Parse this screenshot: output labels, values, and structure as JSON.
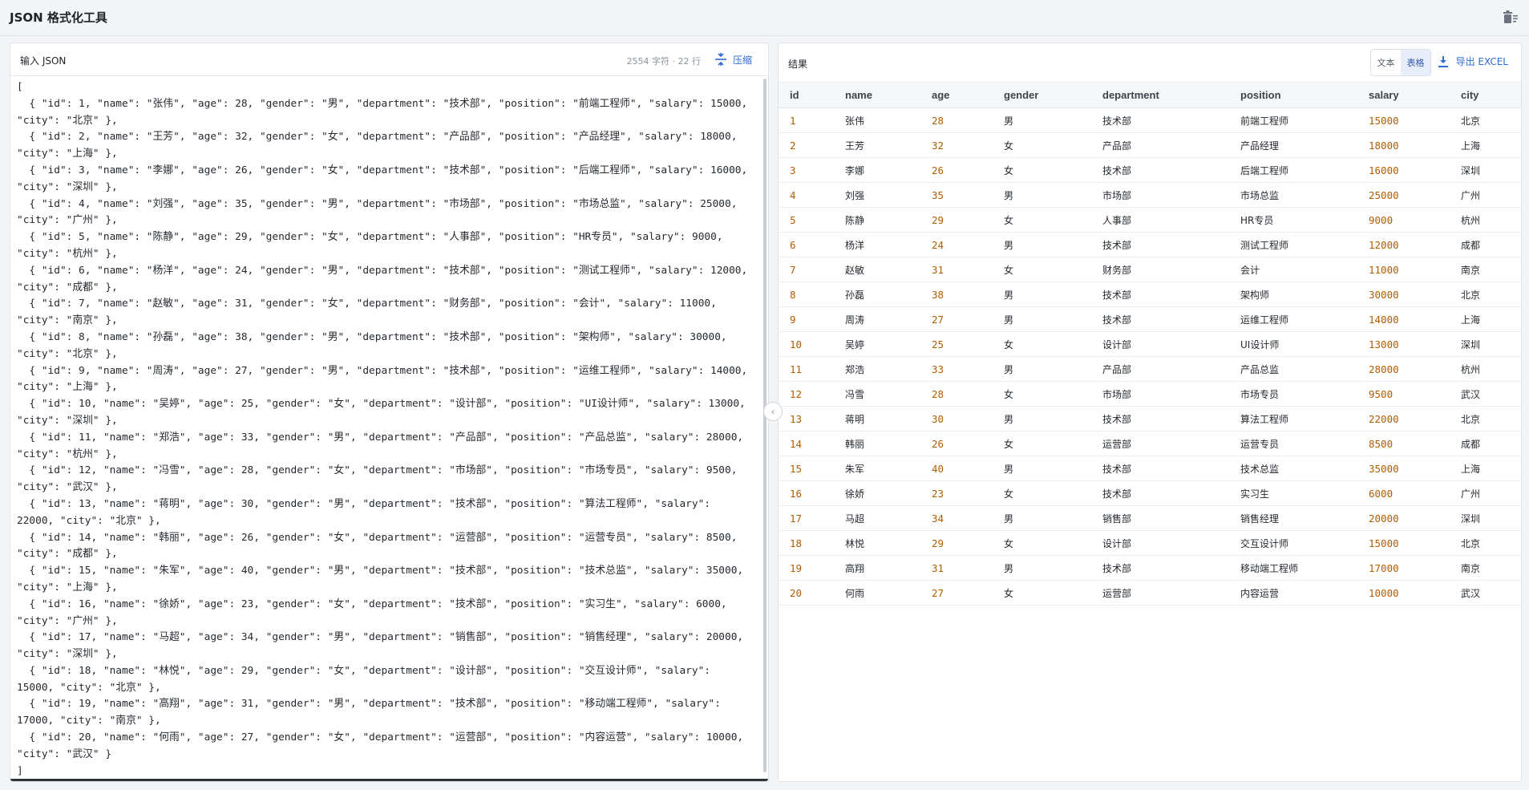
{
  "app": {
    "title": "JSON 格式化工具",
    "trash_icon": "trash-icon"
  },
  "input": {
    "label": "输入 JSON",
    "stats": "2554 字符 · 22 行",
    "compress_label": "压缩",
    "compress_icon": "compress-icon",
    "text": "[\n  { \"id\": 1, \"name\": \"张伟\", \"age\": 28, \"gender\": \"男\", \"department\": \"技术部\", \"position\": \"前端工程师\", \"salary\": 15000,\n\"city\": \"北京\" },\n  { \"id\": 2, \"name\": \"王芳\", \"age\": 32, \"gender\": \"女\", \"department\": \"产品部\", \"position\": \"产品经理\", \"salary\": 18000,\n\"city\": \"上海\" },\n  { \"id\": 3, \"name\": \"李娜\", \"age\": 26, \"gender\": \"女\", \"department\": \"技术部\", \"position\": \"后端工程师\", \"salary\": 16000,\n\"city\": \"深圳\" },\n  { \"id\": 4, \"name\": \"刘强\", \"age\": 35, \"gender\": \"男\", \"department\": \"市场部\", \"position\": \"市场总监\", \"salary\": 25000,\n\"city\": \"广州\" },\n  { \"id\": 5, \"name\": \"陈静\", \"age\": 29, \"gender\": \"女\", \"department\": \"人事部\", \"position\": \"HR专员\", \"salary\": 9000,\n\"city\": \"杭州\" },\n  { \"id\": 6, \"name\": \"杨洋\", \"age\": 24, \"gender\": \"男\", \"department\": \"技术部\", \"position\": \"测试工程师\", \"salary\": 12000,\n\"city\": \"成都\" },\n  { \"id\": 7, \"name\": \"赵敏\", \"age\": 31, \"gender\": \"女\", \"department\": \"财务部\", \"position\": \"会计\", \"salary\": 11000,\n\"city\": \"南京\" },\n  { \"id\": 8, \"name\": \"孙磊\", \"age\": 38, \"gender\": \"男\", \"department\": \"技术部\", \"position\": \"架构师\", \"salary\": 30000,\n\"city\": \"北京\" },\n  { \"id\": 9, \"name\": \"周涛\", \"age\": 27, \"gender\": \"男\", \"department\": \"技术部\", \"position\": \"运维工程师\", \"salary\": 14000,\n\"city\": \"上海\" },\n  { \"id\": 10, \"name\": \"吴婷\", \"age\": 25, \"gender\": \"女\", \"department\": \"设计部\", \"position\": \"UI设计师\", \"salary\": 13000,\n\"city\": \"深圳\" },\n  { \"id\": 11, \"name\": \"郑浩\", \"age\": 33, \"gender\": \"男\", \"department\": \"产品部\", \"position\": \"产品总监\", \"salary\": 28000,\n\"city\": \"杭州\" },\n  { \"id\": 12, \"name\": \"冯雪\", \"age\": 28, \"gender\": \"女\", \"department\": \"市场部\", \"position\": \"市场专员\", \"salary\": 9500,\n\"city\": \"武汉\" },\n  { \"id\": 13, \"name\": \"蒋明\", \"age\": 30, \"gender\": \"男\", \"department\": \"技术部\", \"position\": \"算法工程师\", \"salary\":\n22000, \"city\": \"北京\" },\n  { \"id\": 14, \"name\": \"韩丽\", \"age\": 26, \"gender\": \"女\", \"department\": \"运营部\", \"position\": \"运营专员\", \"salary\": 8500,\n\"city\": \"成都\" },\n  { \"id\": 15, \"name\": \"朱军\", \"age\": 40, \"gender\": \"男\", \"department\": \"技术部\", \"position\": \"技术总监\", \"salary\": 35000,\n\"city\": \"上海\" },\n  { \"id\": 16, \"name\": \"徐娇\", \"age\": 23, \"gender\": \"女\", \"department\": \"技术部\", \"position\": \"实习生\", \"salary\": 6000,\n\"city\": \"广州\" },\n  { \"id\": 17, \"name\": \"马超\", \"age\": 34, \"gender\": \"男\", \"department\": \"销售部\", \"position\": \"销售经理\", \"salary\": 20000,\n\"city\": \"深圳\" },\n  { \"id\": 18, \"name\": \"林悦\", \"age\": 29, \"gender\": \"女\", \"department\": \"设计部\", \"position\": \"交互设计师\", \"salary\":\n15000, \"city\": \"北京\" },\n  { \"id\": 19, \"name\": \"高翔\", \"age\": 31, \"gender\": \"男\", \"department\": \"技术部\", \"position\": \"移动端工程师\", \"salary\":\n17000, \"city\": \"南京\" },\n  { \"id\": 20, \"name\": \"何雨\", \"age\": 27, \"gender\": \"女\", \"department\": \"运营部\", \"position\": \"内容运营\", \"salary\": 10000,\n\"city\": \"武汉\" }\n]"
  },
  "result": {
    "label": "结果",
    "view_text": "文本",
    "view_table": "表格",
    "active_view": "表格",
    "export_label": "导出 EXCEL",
    "export_icon": "download-icon",
    "columns": [
      "id",
      "name",
      "age",
      "gender",
      "department",
      "position",
      "salary",
      "city"
    ],
    "rows": [
      [
        "1",
        "张伟",
        "28",
        "男",
        "技术部",
        "前端工程师",
        "15000",
        "北京"
      ],
      [
        "2",
        "王芳",
        "32",
        "女",
        "产品部",
        "产品经理",
        "18000",
        "上海"
      ],
      [
        "3",
        "李娜",
        "26",
        "女",
        "技术部",
        "后端工程师",
        "16000",
        "深圳"
      ],
      [
        "4",
        "刘强",
        "35",
        "男",
        "市场部",
        "市场总监",
        "25000",
        "广州"
      ],
      [
        "5",
        "陈静",
        "29",
        "女",
        "人事部",
        "HR专员",
        "9000",
        "杭州"
      ],
      [
        "6",
        "杨洋",
        "24",
        "男",
        "技术部",
        "测试工程师",
        "12000",
        "成都"
      ],
      [
        "7",
        "赵敏",
        "31",
        "女",
        "财务部",
        "会计",
        "11000",
        "南京"
      ],
      [
        "8",
        "孙磊",
        "38",
        "男",
        "技术部",
        "架构师",
        "30000",
        "北京"
      ],
      [
        "9",
        "周涛",
        "27",
        "男",
        "技术部",
        "运维工程师",
        "14000",
        "上海"
      ],
      [
        "10",
        "吴婷",
        "25",
        "女",
        "设计部",
        "UI设计师",
        "13000",
        "深圳"
      ],
      [
        "11",
        "郑浩",
        "33",
        "男",
        "产品部",
        "产品总监",
        "28000",
        "杭州"
      ],
      [
        "12",
        "冯雪",
        "28",
        "女",
        "市场部",
        "市场专员",
        "9500",
        "武汉"
      ],
      [
        "13",
        "蒋明",
        "30",
        "男",
        "技术部",
        "算法工程师",
        "22000",
        "北京"
      ],
      [
        "14",
        "韩丽",
        "26",
        "女",
        "运营部",
        "运营专员",
        "8500",
        "成都"
      ],
      [
        "15",
        "朱军",
        "40",
        "男",
        "技术部",
        "技术总监",
        "35000",
        "上海"
      ],
      [
        "16",
        "徐娇",
        "23",
        "女",
        "技术部",
        "实习生",
        "6000",
        "广州"
      ],
      [
        "17",
        "马超",
        "34",
        "男",
        "销售部",
        "销售经理",
        "20000",
        "深圳"
      ],
      [
        "18",
        "林悦",
        "29",
        "女",
        "设计部",
        "交互设计师",
        "15000",
        "北京"
      ],
      [
        "19",
        "高翔",
        "31",
        "男",
        "技术部",
        "移动端工程师",
        "17000",
        "南京"
      ],
      [
        "20",
        "何雨",
        "27",
        "女",
        "运营部",
        "内容运营",
        "10000",
        "武汉"
      ]
    ],
    "numeric_columns": [
      0,
      2,
      6
    ]
  },
  "colors": {
    "accent": "#2f6bd1",
    "numeric": "#b35c00",
    "toggle_active_bg": "#e8eef9"
  }
}
